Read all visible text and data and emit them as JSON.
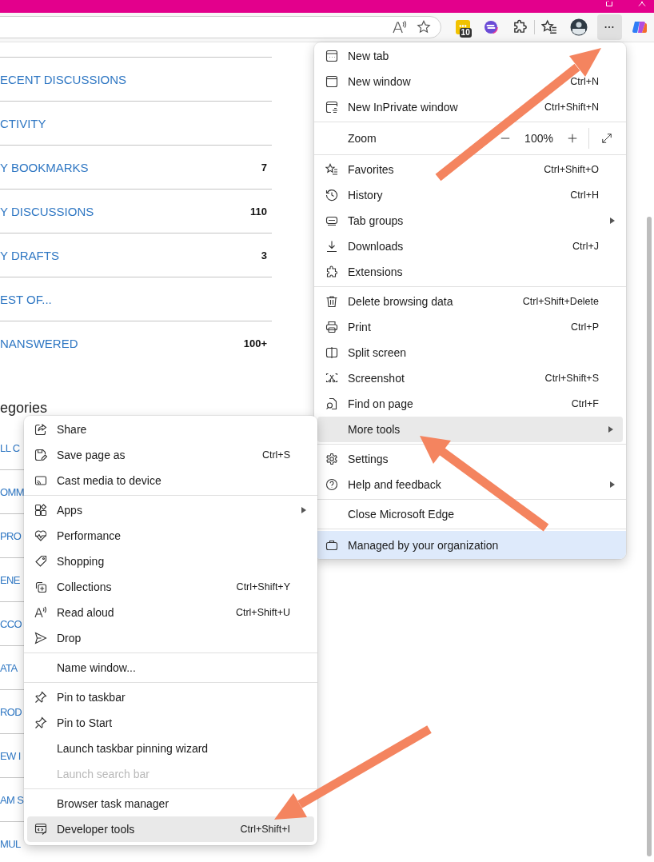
{
  "toolbar": {
    "extension_badge": "10"
  },
  "page_list": [
    {
      "label": "ECENT DISCUSSIONS"
    },
    {
      "label": "CTIVITY"
    },
    {
      "label": "Y BOOKMARKS",
      "count": "7"
    },
    {
      "label": "Y DISCUSSIONS",
      "count": "110"
    },
    {
      "label": "Y DRAFTS",
      "count": "3"
    },
    {
      "label": "EST OF..."
    },
    {
      "label": "NANSWERED",
      "count": "100+"
    }
  ],
  "categories_heading": "egories",
  "category_rows": [
    "LL C",
    "OMM",
    "PRO",
    "ENE",
    "CCO",
    "ATA",
    "ROD",
    "EW I",
    "AM S",
    "MUL"
  ],
  "main_menu": {
    "sections": [
      {
        "items": [
          {
            "kind": "item",
            "label": "New tab",
            "has_submenu": false,
            "selected": false
          },
          {
            "kind": "item",
            "label": "New window",
            "shortcut": "Ctrl+N",
            "has_submenu": false,
            "selected": false
          },
          {
            "kind": "item",
            "label": "New InPrivate window",
            "shortcut": "Ctrl+Shift+N",
            "has_submenu": false,
            "selected": false
          }
        ]
      },
      {
        "items": [
          {
            "kind": "zoom",
            "label": "Zoom",
            "value": "100%"
          }
        ]
      },
      {
        "items": [
          {
            "kind": "item",
            "label": "Favorites",
            "shortcut": "Ctrl+Shift+O",
            "has_submenu": false,
            "selected": false
          },
          {
            "kind": "item",
            "label": "History",
            "shortcut": "Ctrl+H",
            "has_submenu": false,
            "selected": false
          },
          {
            "kind": "item",
            "label": "Tab groups",
            "has_submenu": true,
            "selected": false
          },
          {
            "kind": "item",
            "label": "Downloads",
            "shortcut": "Ctrl+J",
            "has_submenu": false,
            "selected": false
          },
          {
            "kind": "item",
            "label": "Extensions",
            "has_submenu": false,
            "selected": false
          }
        ]
      },
      {
        "items": [
          {
            "kind": "item",
            "label": "Delete browsing data",
            "shortcut": "Ctrl+Shift+Delete",
            "has_submenu": false,
            "selected": false
          },
          {
            "kind": "item",
            "label": "Print",
            "shortcut": "Ctrl+P",
            "has_submenu": false,
            "selected": false
          },
          {
            "kind": "item",
            "label": "Split screen",
            "has_submenu": false,
            "selected": false
          },
          {
            "kind": "item",
            "label": "Screenshot",
            "shortcut": "Ctrl+Shift+S",
            "has_submenu": false,
            "selected": false
          },
          {
            "kind": "item",
            "label": "Find on page",
            "shortcut": "Ctrl+F",
            "has_submenu": false,
            "selected": false
          },
          {
            "kind": "item",
            "label": "More tools",
            "has_submenu": true,
            "selected": true
          }
        ]
      },
      {
        "items": [
          {
            "kind": "item",
            "label": "Settings",
            "has_submenu": false,
            "selected": false
          },
          {
            "kind": "item",
            "label": "Help and feedback",
            "has_submenu": true,
            "selected": false
          }
        ]
      },
      {
        "items": [
          {
            "kind": "item",
            "label": "Close Microsoft Edge",
            "has_submenu": false,
            "selected": false
          }
        ]
      },
      {
        "items": [
          {
            "kind": "notice",
            "label": "Managed by your organization"
          }
        ]
      }
    ]
  },
  "more_tools_menu": {
    "sections": [
      {
        "items": [
          {
            "kind": "item",
            "label": "Share",
            "has_submenu": false,
            "selected": false,
            "disabled": false
          },
          {
            "kind": "item",
            "label": "Save page as",
            "shortcut": "Ctrl+S",
            "has_submenu": false,
            "selected": false,
            "disabled": false
          },
          {
            "kind": "item",
            "label": "Cast media to device",
            "has_submenu": false,
            "selected": false,
            "disabled": false
          }
        ]
      },
      {
        "items": [
          {
            "kind": "item",
            "label": "Apps",
            "has_submenu": true,
            "selected": false,
            "disabled": false
          },
          {
            "kind": "item",
            "label": "Performance",
            "has_submenu": false,
            "selected": false,
            "disabled": false
          },
          {
            "kind": "item",
            "label": "Shopping",
            "has_submenu": false,
            "selected": false,
            "disabled": false
          },
          {
            "kind": "item",
            "label": "Collections",
            "shortcut": "Ctrl+Shift+Y",
            "has_submenu": false,
            "selected": false,
            "disabled": false
          },
          {
            "kind": "item",
            "label": "Read aloud",
            "shortcut": "Ctrl+Shift+U",
            "has_submenu": false,
            "selected": false,
            "disabled": false
          },
          {
            "kind": "item",
            "label": "Drop",
            "has_submenu": false,
            "selected": false,
            "disabled": false
          }
        ]
      },
      {
        "items": [
          {
            "kind": "item",
            "label": "Name window...",
            "has_submenu": false,
            "selected": false,
            "disabled": false
          }
        ]
      },
      {
        "items": [
          {
            "kind": "item",
            "label": "Pin to taskbar",
            "has_submenu": false,
            "selected": false,
            "disabled": false
          },
          {
            "kind": "item",
            "label": "Pin to Start",
            "has_submenu": false,
            "selected": false,
            "disabled": false
          },
          {
            "kind": "item",
            "label": "Launch taskbar pinning wizard",
            "has_submenu": false,
            "selected": false,
            "disabled": false
          },
          {
            "kind": "item",
            "label": "Launch search bar",
            "has_submenu": false,
            "selected": false,
            "disabled": true
          }
        ]
      },
      {
        "items": [
          {
            "kind": "item",
            "label": "Browser task manager",
            "has_submenu": false,
            "selected": false,
            "disabled": false
          },
          {
            "kind": "item",
            "label": "Developer tools",
            "shortcut": "Ctrl+Shift+I",
            "has_submenu": false,
            "selected": true,
            "disabled": false
          }
        ]
      }
    ]
  }
}
